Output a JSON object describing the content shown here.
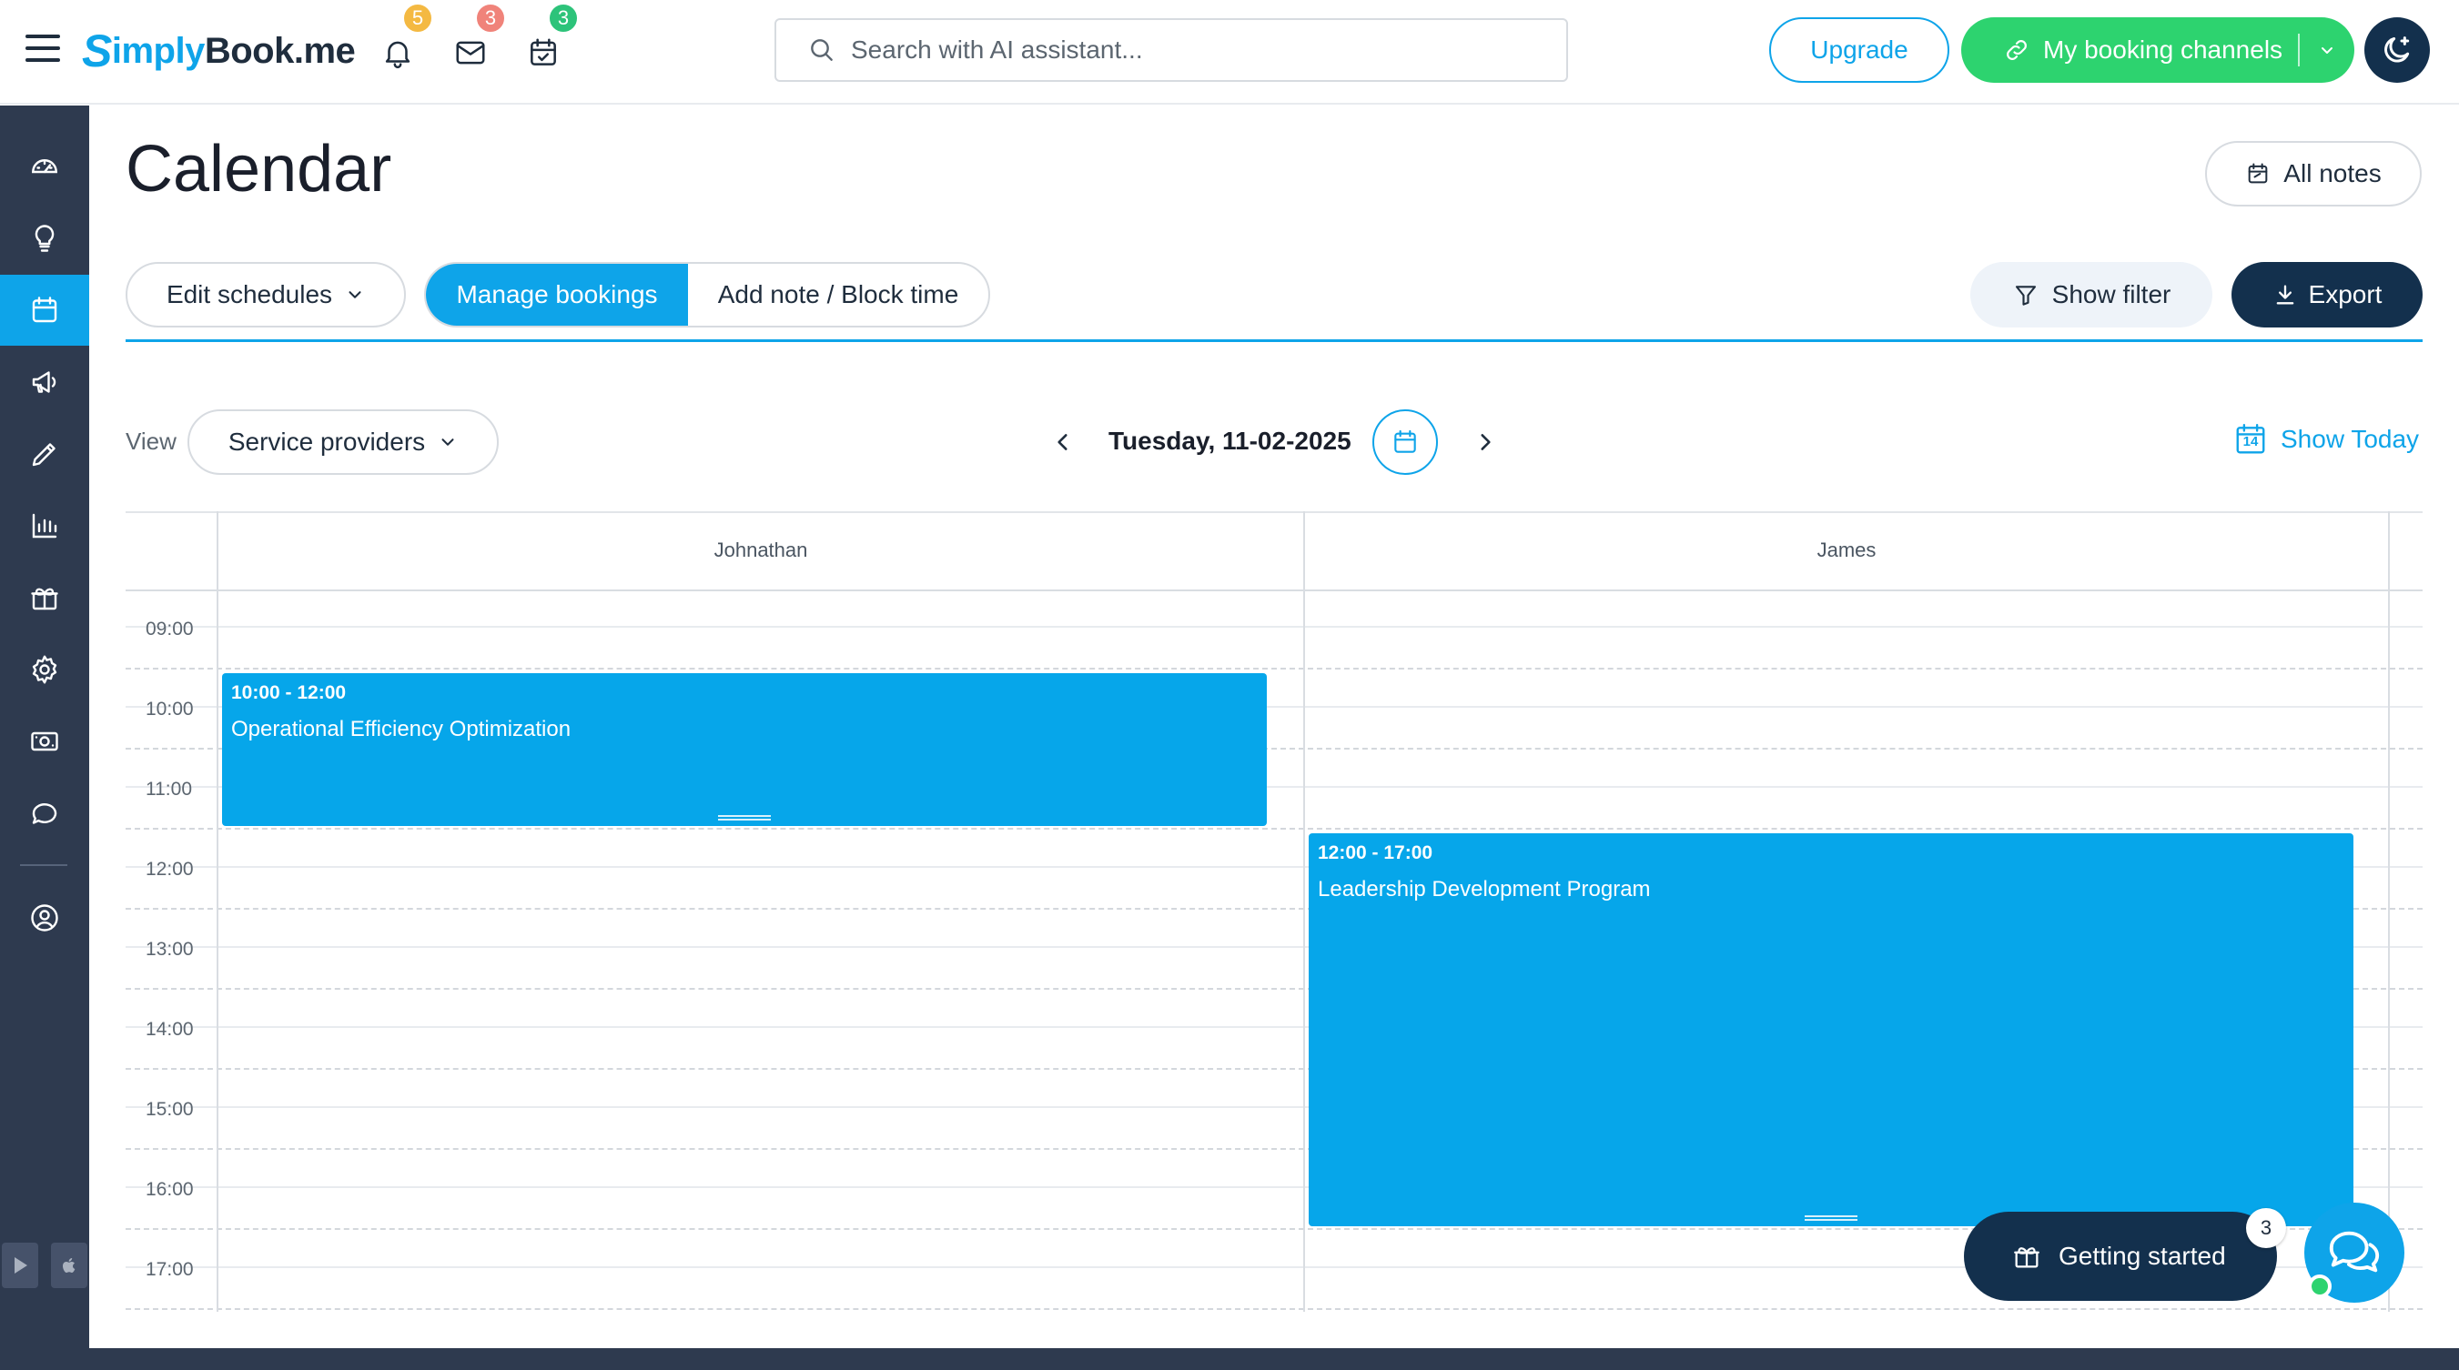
{
  "header": {
    "logo": {
      "s": "S",
      "a": "imply",
      "b": "Book",
      "c": ".me"
    },
    "notifications_count": "5",
    "messages_count": "3",
    "tasks_count": "3",
    "search_placeholder": "Search with AI assistant...",
    "upgrade_label": "Upgrade",
    "channels_label": "My booking channels"
  },
  "sidebar": {
    "items": [
      "dashboard",
      "ideas",
      "calendar",
      "marketing",
      "editor",
      "reports",
      "add-ons",
      "settings",
      "payments",
      "chat",
      "account"
    ],
    "active": "calendar"
  },
  "page": {
    "title": "Calendar",
    "all_notes_label": "All notes",
    "edit_schedules_label": "Edit schedules",
    "manage_bookings_label": "Manage bookings",
    "add_note_label": "Add note / Block time",
    "show_filter_label": "Show filter",
    "export_label": "Export"
  },
  "view": {
    "label": "View",
    "selected": "Service providers",
    "date": "Tuesday, 11-02-2025",
    "show_today_label": "Show Today",
    "today_day": "14"
  },
  "calendar": {
    "columns": [
      "Johnathan",
      "James"
    ],
    "times": [
      "09:00",
      "10:00",
      "11:00",
      "12:00",
      "13:00",
      "14:00",
      "15:00",
      "16:00",
      "17:00"
    ],
    "bookings": [
      {
        "provider": "Johnathan",
        "time": "10:00 - 12:00",
        "title": "Operational Efficiency Optimization"
      },
      {
        "provider": "James",
        "time": "12:00 - 17:00",
        "title": "Leadership Development Program"
      }
    ]
  },
  "widgets": {
    "getting_started_label": "Getting started",
    "getting_started_count": "3"
  },
  "colors": {
    "accent": "#0ea4e9",
    "booking": "#06a6ea",
    "green": "#2dd36f",
    "navy": "#13304d",
    "sidebar": "#2e3a4f",
    "badge_notifications": "#f4b942",
    "badge_messages": "#f0837a",
    "badge_tasks": "#2dc37a"
  }
}
